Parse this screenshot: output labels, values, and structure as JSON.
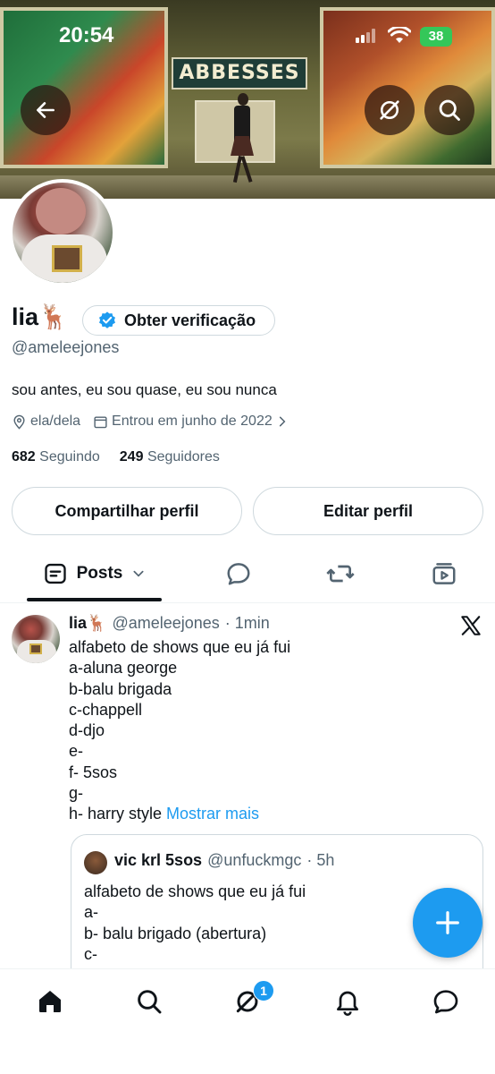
{
  "status_bar": {
    "time": "20:54",
    "battery": "38"
  },
  "banner": {
    "station_name": "ABBESSES"
  },
  "profile": {
    "name": "lia🦌",
    "verify_button": "Obter verificação",
    "handle": "@ameleejones",
    "bio": "sou antes, eu sou quase, eu sou nunca",
    "pronouns": "ela/dela",
    "joined": "Entrou em junho de 2022",
    "following_count": "682",
    "following_label": "Seguindo",
    "followers_count": "249",
    "followers_label": "Seguidores",
    "share_button": "Compartilhar perfil",
    "edit_button": "Editar perfil"
  },
  "tabs": {
    "posts_label": "Posts"
  },
  "post": {
    "name": "lia🦌",
    "handle": "@ameleejones",
    "time": "· 1min",
    "lines": [
      "alfabeto de shows que eu já fui",
      "a-aluna george",
      "b-balu brigada",
      "c-chappell",
      "d-djo",
      "e-",
      "f- 5sos",
      "g-",
      "h- harry style"
    ],
    "show_more": "Mostrar mais",
    "quote": {
      "name": "vic krl 5sos",
      "handle": "@unfuckmgc",
      "time": "· 5h",
      "lines": [
        "alfabeto de shows que eu já fui",
        "a-",
        "b- balu brigado (abertura)",
        "c-"
      ]
    }
  },
  "bottom_nav": {
    "messages_badge": "1"
  },
  "colors": {
    "accent": "#1d9bf0",
    "text": "#0f1419",
    "muted": "#536471",
    "border": "#cfd9de"
  }
}
